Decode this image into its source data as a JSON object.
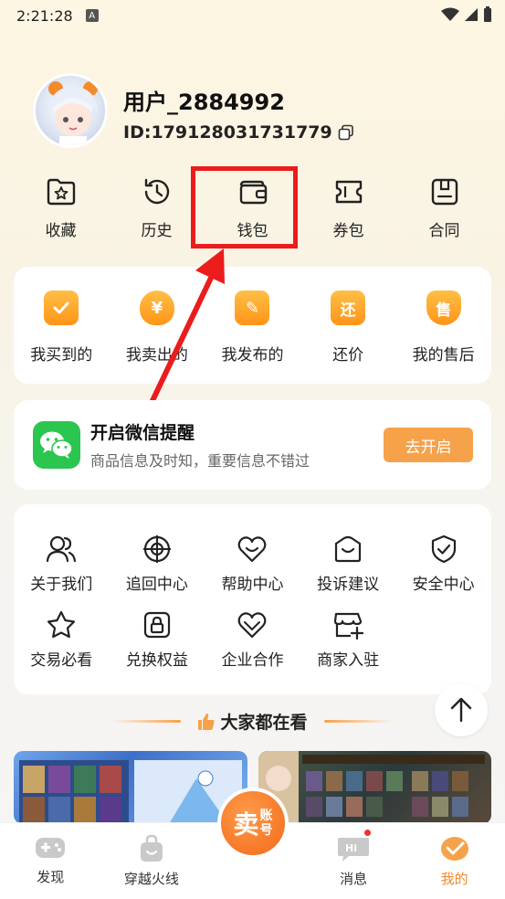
{
  "status_bar": {
    "time": "2:21:28",
    "badge": "A"
  },
  "profile": {
    "username": "用户_2884992",
    "user_id": "ID:179128031731779"
  },
  "quick_actions": [
    {
      "label": "收藏",
      "icon": "star-folder-icon"
    },
    {
      "label": "历史",
      "icon": "history-clock-icon"
    },
    {
      "label": "钱包",
      "icon": "wallet-icon"
    },
    {
      "label": "券包",
      "icon": "ticket-icon"
    },
    {
      "label": "合同",
      "icon": "contract-icon"
    }
  ],
  "orders": [
    {
      "label": "我买到的",
      "icon": "shopping-bag-check-icon",
      "glyph": "✓"
    },
    {
      "label": "我卖出的",
      "icon": "money-bag-icon",
      "glyph": "¥"
    },
    {
      "label": "我发布的",
      "icon": "edit-folder-icon",
      "glyph": "✎"
    },
    {
      "label": "还价",
      "icon": "counter-offer-icon",
      "glyph": "还"
    },
    {
      "label": "我的售后",
      "icon": "after-sale-shield-icon",
      "glyph": "售"
    }
  ],
  "wechat": {
    "title": "开启微信提醒",
    "subtitle": "商品信息及时知，重要信息不错过",
    "button": "去开启"
  },
  "services": [
    {
      "label": "关于我们",
      "icon": "users-icon"
    },
    {
      "label": "追回中心",
      "icon": "crosshair-icon"
    },
    {
      "label": "帮助中心",
      "icon": "heart-help-icon"
    },
    {
      "label": "投诉建议",
      "icon": "complaint-icon"
    },
    {
      "label": "安全中心",
      "icon": "shield-check-icon"
    },
    {
      "label": "交易必看",
      "icon": "star-outline-icon"
    },
    {
      "label": "兑换权益",
      "icon": "lock-exchange-icon"
    },
    {
      "label": "企业合作",
      "icon": "handshake-heart-icon"
    },
    {
      "label": "商家入驻",
      "icon": "store-add-icon"
    }
  ],
  "hot_section": {
    "title": "大家都在看"
  },
  "tabs": [
    {
      "label": "发现",
      "icon": "gamepad-icon"
    },
    {
      "label": "穿越火线",
      "icon": "bag-icon"
    },
    {
      "label": "",
      "icon": "sell-account-icon"
    },
    {
      "label": "消息",
      "icon": "message-bubble-icon"
    },
    {
      "label": "我的",
      "icon": "profile-check-icon"
    }
  ],
  "sell_button": {
    "big": "卖",
    "small_top": "账",
    "small_bottom": "号"
  },
  "colors": {
    "accent": "#f08a2c",
    "wechat_green": "#2ac64f",
    "highlight_red": "#ec1c1c"
  }
}
